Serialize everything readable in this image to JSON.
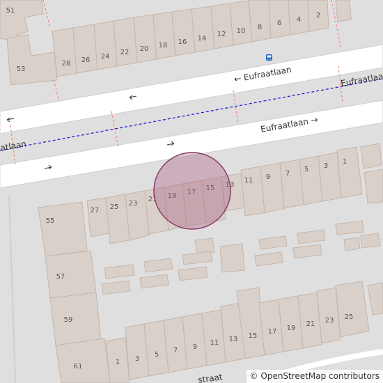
{
  "map": {
    "streets": [
      {
        "name": "Eufraatlaan",
        "label": "← Eufraatlaan"
      },
      {
        "name": "Eufraatlaan",
        "label": "Eufraatlaan →"
      },
      {
        "name": "Eufraatlaan",
        "label": "Eufraatlaan"
      },
      {
        "name": "aatlaan",
        "label": "aatlaan"
      },
      {
        "name": "straat",
        "label": "straat"
      }
    ],
    "house_numbers_top": [
      "51",
      "53",
      "28",
      "26",
      "24",
      "22",
      "20",
      "18",
      "16",
      "14",
      "12",
      "10",
      "8",
      "6",
      "4",
      "2"
    ],
    "house_numbers_middle": [
      "27",
      "25",
      "23",
      "21",
      "19",
      "17",
      "15",
      "13",
      "11",
      "9",
      "7",
      "5",
      "3",
      "1",
      "55",
      "57",
      "59",
      "61"
    ],
    "house_numbers_bottom": [
      "1",
      "3",
      "5",
      "7",
      "9",
      "11",
      "13",
      "15",
      "17",
      "19",
      "21",
      "23",
      "25"
    ],
    "highlight_marker": {
      "color": "#a5577a",
      "target_house": "17"
    },
    "bus_stop_icon": "bus-stop-icon",
    "colors": {
      "road": "#ffffff",
      "building": "#d9d0c9",
      "background": "#e0dfdf",
      "tram": "#1c1fd6",
      "footway": "#fa8072"
    }
  },
  "attribution": {
    "symbol": "©",
    "text": "OpenStreetMap contributors"
  }
}
